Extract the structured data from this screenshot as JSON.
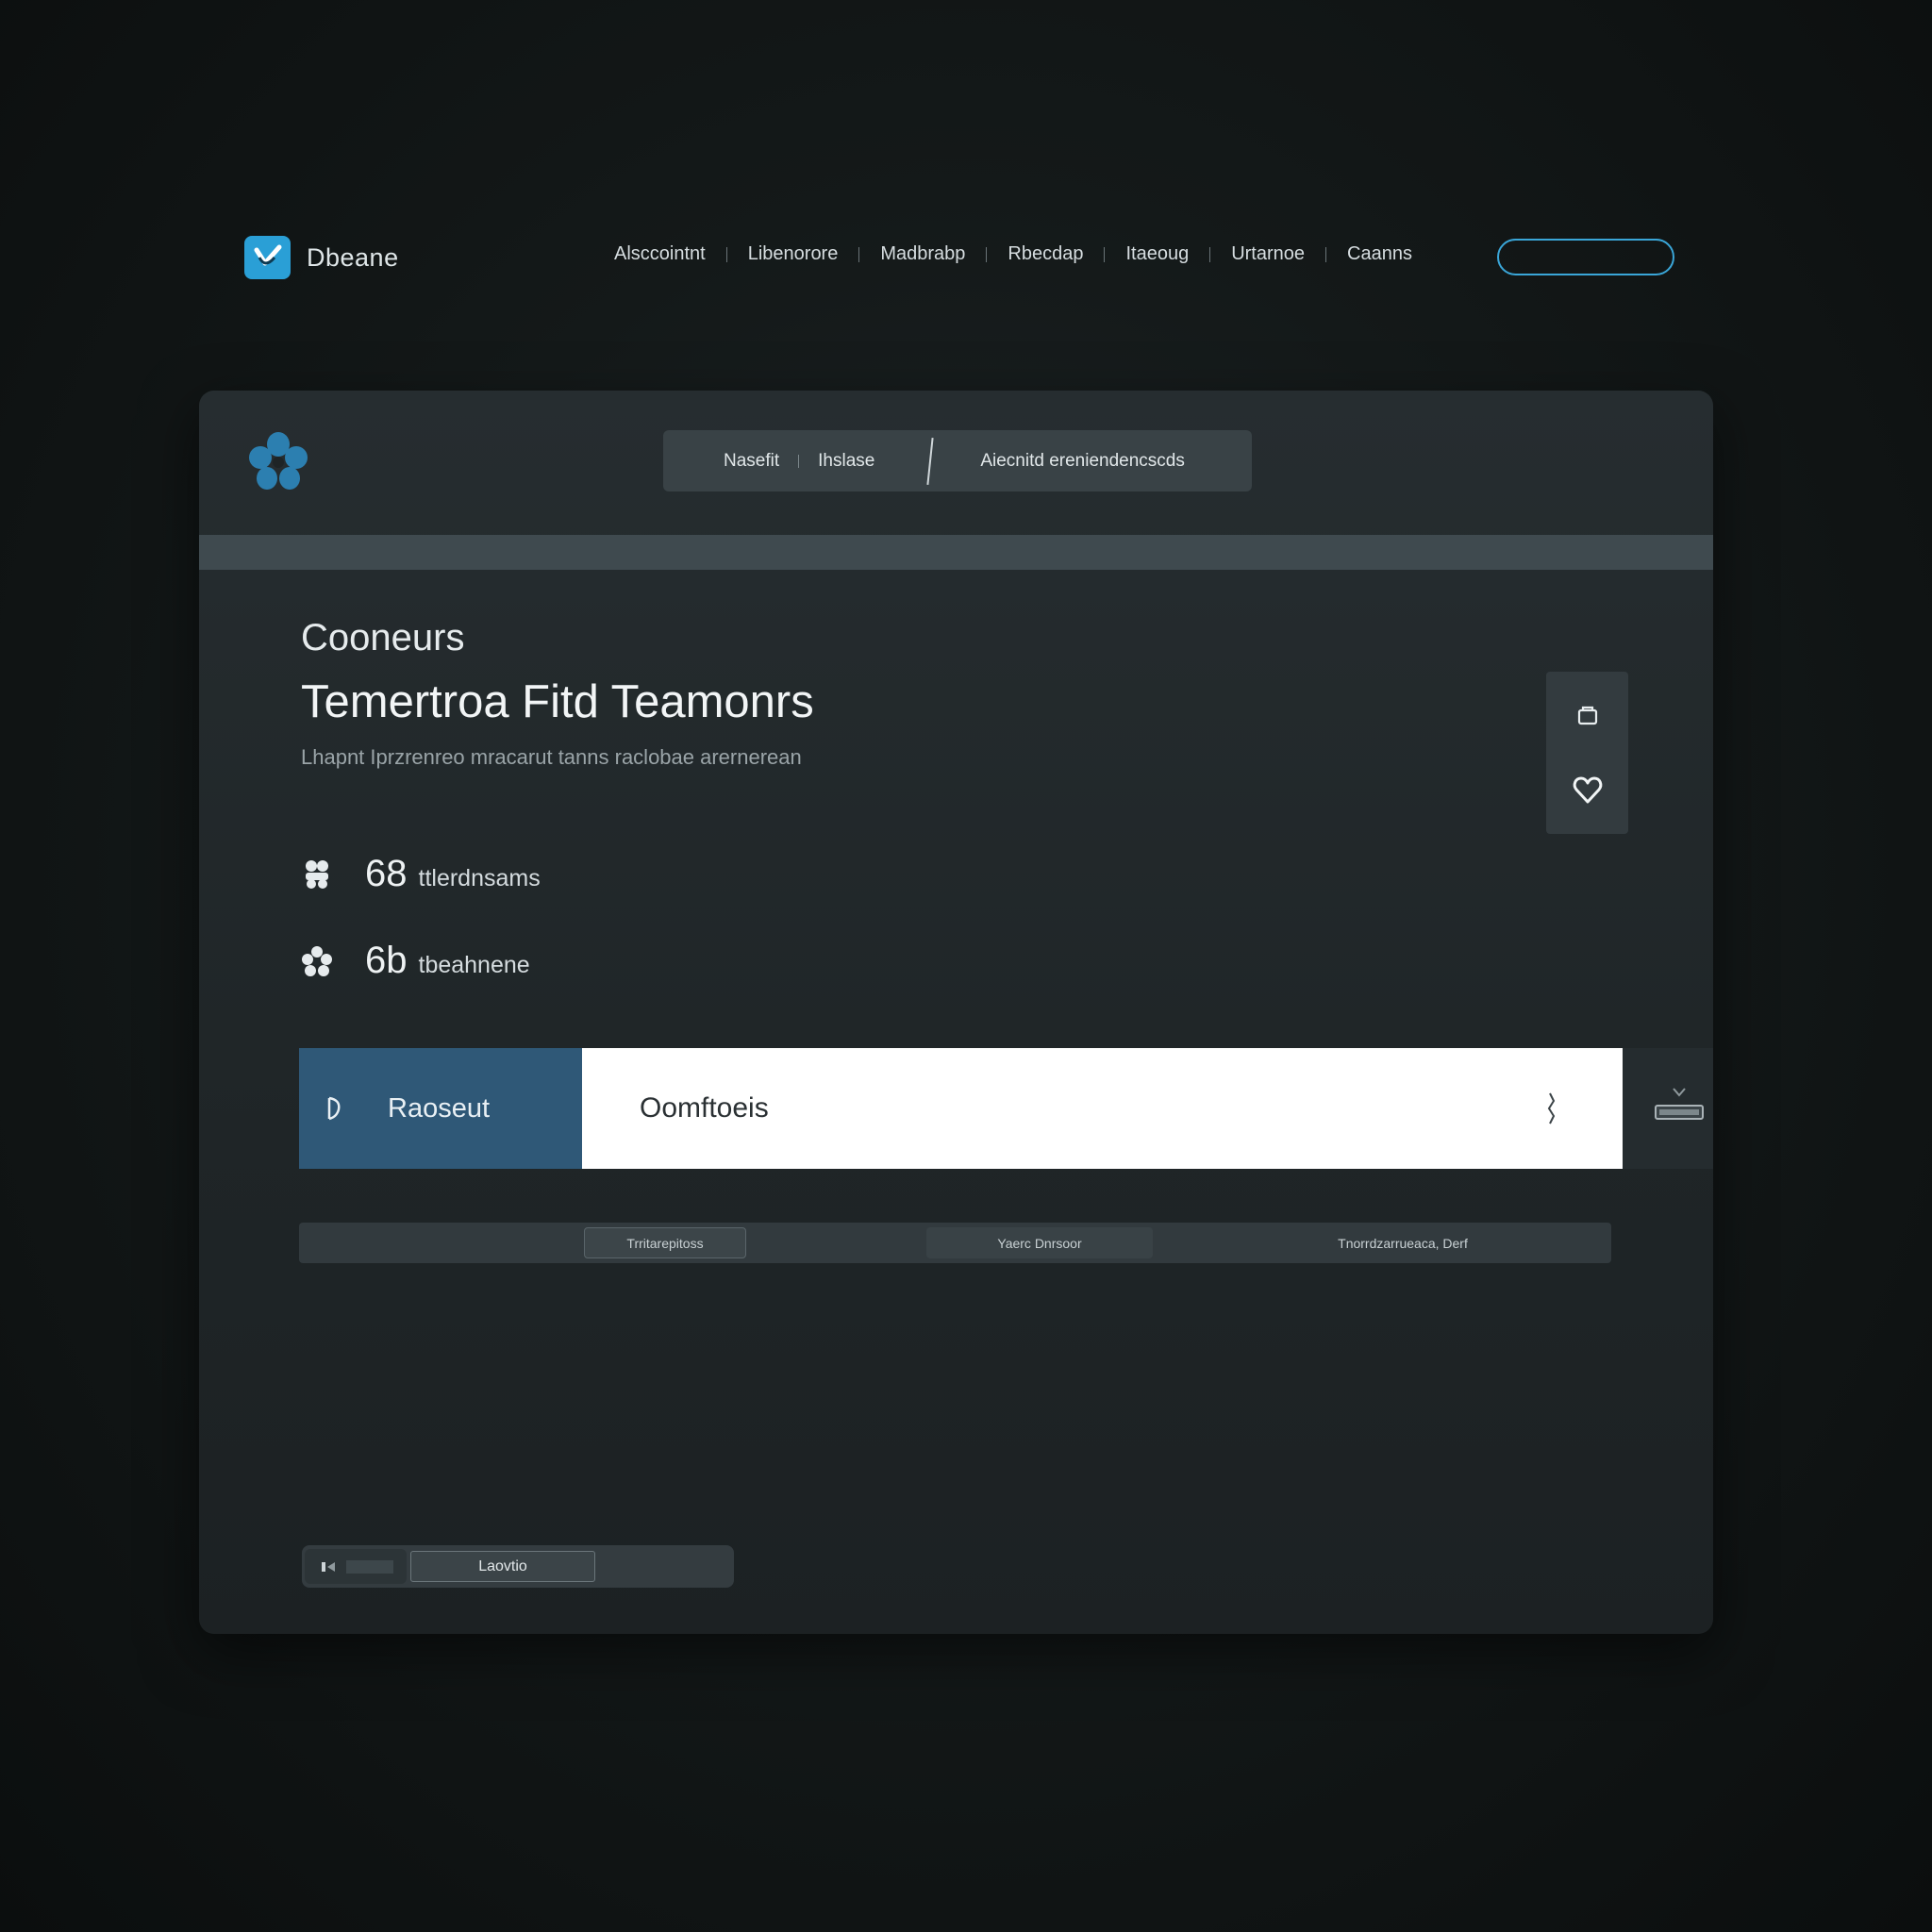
{
  "brand": {
    "name": "Dbeane"
  },
  "nav": {
    "links": [
      "Alsccointnt",
      "Libenorore",
      "Madbrabp",
      "Rbecdap",
      "Itaeoug",
      "Urtarnoe",
      "Caanns"
    ],
    "cta_label": ""
  },
  "card": {
    "segmented": {
      "item1": "Nasefit",
      "item2": "Ihslase",
      "item3": "Aiecnitd ereniendencscds"
    },
    "eyebrow": "Cooneurs",
    "headline": "Temertroa Fitd Teamonrs",
    "subline": "Lhapnt Iprzrenreo mracarut tanns raclobae arernerean",
    "stats": [
      {
        "icon": "team-icon",
        "value": "68",
        "label": "ttlerdnsams"
      },
      {
        "icon": "flower-icon",
        "value": "6b",
        "label": "tbeahnene"
      }
    ],
    "search": {
      "select_label": "Raoseut",
      "input_value": "Oomftoeis"
    },
    "filters": [
      "Trritarepitoss",
      "Yaerc Dnrsoor",
      "Tnorrdzarrueaca, Derf"
    ],
    "pager": {
      "page_label": "Laovtio"
    }
  },
  "colors": {
    "accent": "#2a9fd6",
    "cta_border": "#3aa6d8",
    "select_bg": "#2f5877",
    "card_bg": "#262d30",
    "band": "#3f4a4f"
  }
}
